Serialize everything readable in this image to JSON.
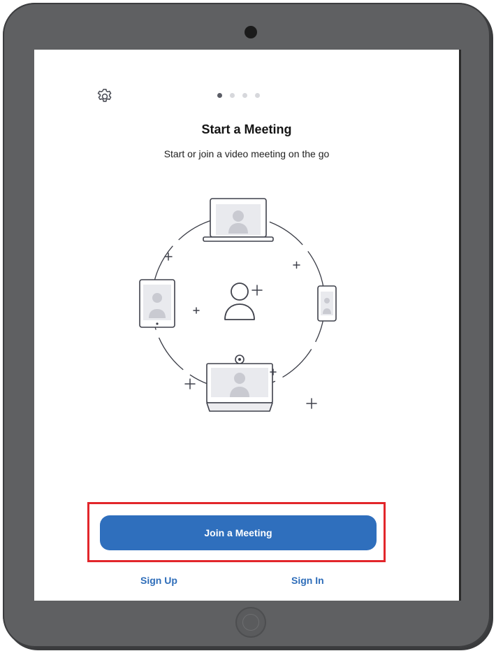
{
  "onboarding": {
    "title": "Start a Meeting",
    "subtitle": "Start or join a video meeting on the go",
    "page_count": 4,
    "active_page": 1
  },
  "actions": {
    "join_label": "Join a Meeting",
    "signup_label": "Sign Up",
    "signin_label": "Sign In"
  },
  "icons": {
    "settings": "gear-icon"
  },
  "colors": {
    "primary_button": "#2f6fbd",
    "link": "#2e6db9",
    "highlight_box": "#e2262b",
    "device_frame": "#5f6062"
  }
}
